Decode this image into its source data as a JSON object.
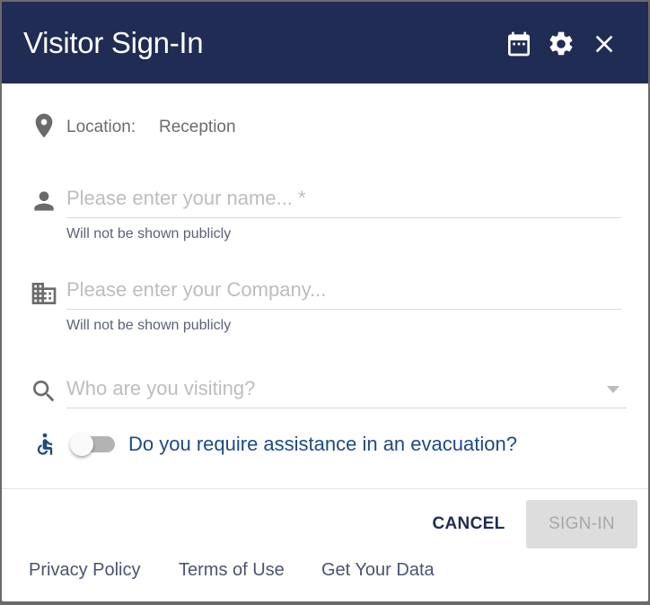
{
  "header": {
    "title": "Visitor Sign-In",
    "icons": [
      "calendar-icon",
      "gear-icon",
      "close-icon"
    ],
    "background": "#202c54"
  },
  "location": {
    "label": "Location:",
    "value": "Reception"
  },
  "name_field": {
    "placeholder": "Please enter your name... *",
    "value": "",
    "helper": "Will not be shown publicly"
  },
  "company_field": {
    "placeholder": "Please enter your Company...",
    "value": "",
    "helper": "Will not be shown publicly"
  },
  "visiting_field": {
    "placeholder": "Who are you visiting?",
    "value": ""
  },
  "evacuation": {
    "label": "Do you require assistance in an evacuation?",
    "checked": false
  },
  "actions": {
    "cancel_label": "CANCEL",
    "signin_label": "SIGN-IN",
    "signin_disabled": true
  },
  "footer": {
    "links": [
      "Privacy Policy",
      "Terms of Use",
      "Get Your Data"
    ]
  }
}
